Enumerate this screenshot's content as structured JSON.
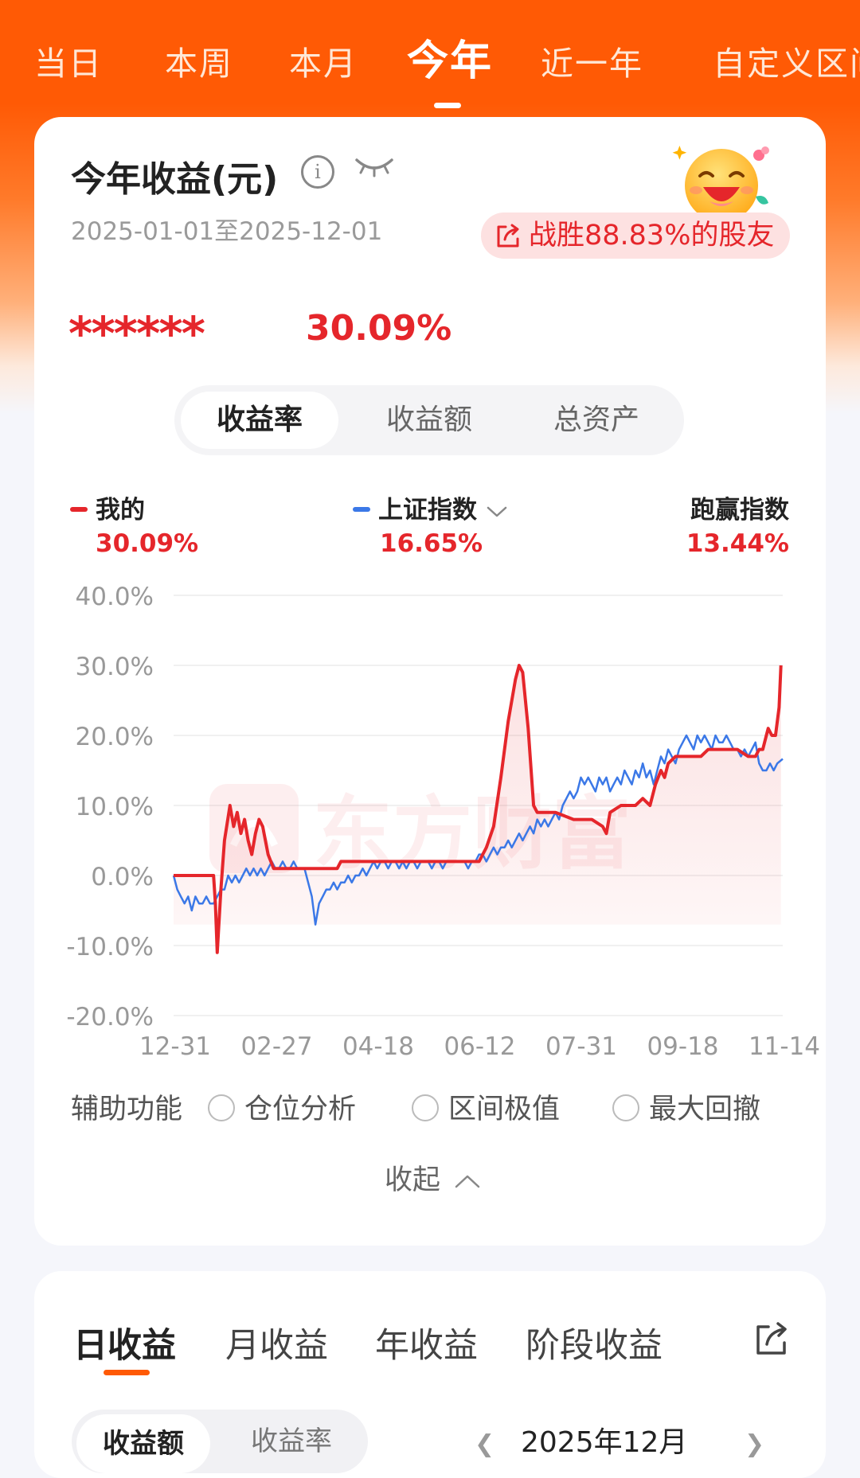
{
  "top_tabs": [
    "当日",
    "本周",
    "本月",
    "今年",
    "近一年",
    "自定义区间"
  ],
  "top_tabs_active": "今年",
  "summary": {
    "title": "今年收益(元)",
    "date_range": "2025-01-01至2025-12-01",
    "beat_text": "战胜88.83%的股友",
    "masked_amount": "******",
    "return_pct": "30.09%"
  },
  "metric_tabs": [
    "收益率",
    "收益额",
    "总资产"
  ],
  "metric_tabs_active": "收益率",
  "legend": {
    "mine_label": "我的",
    "mine_value": "30.09%",
    "index_label": "上证指数",
    "index_value": "16.65%",
    "excess_label": "跑赢指数",
    "excess_value": "13.44%"
  },
  "watermark": "东方财富",
  "chart_data": {
    "type": "line",
    "ylim": [
      -20,
      40
    ],
    "yticks": [
      "40.0%",
      "30.0%",
      "20.0%",
      "10.0%",
      "0.0%",
      "-10.0%",
      "-20.0%"
    ],
    "xticks": [
      "12-31",
      "02-27",
      "04-18",
      "06-12",
      "07-31",
      "09-18",
      "11-14"
    ],
    "x_range_days": [
      0,
      335
    ],
    "colors": {
      "mine": "#e5262b",
      "index": "#3b78e7"
    },
    "series": [
      {
        "name": "我的",
        "points": [
          [
            0,
            0
          ],
          [
            22,
            0
          ],
          [
            23,
            -4
          ],
          [
            24,
            -11
          ],
          [
            26,
            -2
          ],
          [
            28,
            5
          ],
          [
            31,
            10
          ],
          [
            33,
            7
          ],
          [
            35,
            9
          ],
          [
            37,
            6
          ],
          [
            39,
            8
          ],
          [
            41,
            5
          ],
          [
            43,
            3
          ],
          [
            45,
            6
          ],
          [
            47,
            8
          ],
          [
            49,
            7
          ],
          [
            52,
            3
          ],
          [
            55,
            1
          ],
          [
            58,
            1
          ],
          [
            62,
            1
          ],
          [
            66,
            1
          ],
          [
            72,
            1
          ],
          [
            80,
            1
          ],
          [
            90,
            1
          ],
          [
            92,
            2
          ],
          [
            100,
            2
          ],
          [
            120,
            2
          ],
          [
            140,
            2
          ],
          [
            160,
            2
          ],
          [
            168,
            2
          ],
          [
            170,
            3
          ],
          [
            172,
            4
          ],
          [
            176,
            7
          ],
          [
            180,
            14
          ],
          [
            184,
            22
          ],
          [
            188,
            28
          ],
          [
            190,
            30
          ],
          [
            192,
            29
          ],
          [
            195,
            21
          ],
          [
            198,
            10
          ],
          [
            200,
            9
          ],
          [
            204,
            9
          ],
          [
            210,
            9
          ],
          [
            220,
            8
          ],
          [
            230,
            8
          ],
          [
            236,
            7
          ],
          [
            238,
            6
          ],
          [
            240,
            9
          ],
          [
            246,
            10
          ],
          [
            254,
            10
          ],
          [
            258,
            11
          ],
          [
            262,
            10
          ],
          [
            265,
            13
          ],
          [
            268,
            15
          ],
          [
            270,
            14
          ],
          [
            272,
            16
          ],
          [
            276,
            17
          ],
          [
            285,
            17
          ],
          [
            290,
            17
          ],
          [
            294,
            18
          ],
          [
            300,
            18
          ],
          [
            310,
            18
          ],
          [
            316,
            17
          ],
          [
            320,
            17
          ],
          [
            322,
            18
          ],
          [
            324,
            18
          ],
          [
            326,
            20
          ],
          [
            327,
            21
          ],
          [
            329,
            20
          ],
          [
            331,
            20
          ],
          [
            333,
            24
          ],
          [
            334,
            30
          ]
        ]
      },
      {
        "name": "上证指数",
        "points": [
          [
            0,
            0
          ],
          [
            2,
            -2
          ],
          [
            4,
            -3
          ],
          [
            6,
            -4
          ],
          [
            8,
            -3
          ],
          [
            10,
            -5
          ],
          [
            12,
            -3
          ],
          [
            14,
            -4
          ],
          [
            16,
            -4
          ],
          [
            18,
            -3
          ],
          [
            20,
            -4
          ],
          [
            22,
            -4
          ],
          [
            24,
            -3
          ],
          [
            26,
            -2
          ],
          [
            28,
            -2
          ],
          [
            30,
            0
          ],
          [
            32,
            -1
          ],
          [
            34,
            0
          ],
          [
            36,
            -1
          ],
          [
            38,
            0
          ],
          [
            40,
            1
          ],
          [
            42,
            0
          ],
          [
            44,
            1
          ],
          [
            46,
            0
          ],
          [
            48,
            1
          ],
          [
            50,
            0
          ],
          [
            52,
            1
          ],
          [
            54,
            2
          ],
          [
            56,
            1
          ],
          [
            58,
            1
          ],
          [
            60,
            2
          ],
          [
            62,
            1
          ],
          [
            64,
            1
          ],
          [
            66,
            2
          ],
          [
            68,
            1
          ],
          [
            70,
            1
          ],
          [
            72,
            1
          ],
          [
            74,
            -1
          ],
          [
            76,
            -3
          ],
          [
            78,
            -7
          ],
          [
            80,
            -4
          ],
          [
            82,
            -3
          ],
          [
            84,
            -2
          ],
          [
            86,
            -2
          ],
          [
            88,
            -1
          ],
          [
            90,
            -2
          ],
          [
            92,
            -1
          ],
          [
            94,
            -1
          ],
          [
            96,
            0
          ],
          [
            98,
            -1
          ],
          [
            100,
            0
          ],
          [
            102,
            0
          ],
          [
            104,
            1
          ],
          [
            106,
            0
          ],
          [
            108,
            1
          ],
          [
            110,
            2
          ],
          [
            112,
            1
          ],
          [
            114,
            2
          ],
          [
            116,
            2
          ],
          [
            118,
            1
          ],
          [
            120,
            2
          ],
          [
            122,
            2
          ],
          [
            124,
            1
          ],
          [
            126,
            2
          ],
          [
            128,
            1
          ],
          [
            130,
            2
          ],
          [
            132,
            2
          ],
          [
            134,
            1
          ],
          [
            136,
            2
          ],
          [
            138,
            2
          ],
          [
            140,
            2
          ],
          [
            142,
            1
          ],
          [
            144,
            2
          ],
          [
            146,
            2
          ],
          [
            148,
            1
          ],
          [
            150,
            2
          ],
          [
            152,
            2
          ],
          [
            154,
            2
          ],
          [
            156,
            2
          ],
          [
            158,
            2
          ],
          [
            160,
            2
          ],
          [
            162,
            1
          ],
          [
            164,
            2
          ],
          [
            166,
            2
          ],
          [
            168,
            3
          ],
          [
            170,
            3
          ],
          [
            172,
            2
          ],
          [
            174,
            3
          ],
          [
            176,
            4
          ],
          [
            178,
            3
          ],
          [
            180,
            4
          ],
          [
            182,
            4
          ],
          [
            184,
            5
          ],
          [
            186,
            4
          ],
          [
            188,
            5
          ],
          [
            190,
            6
          ],
          [
            192,
            5
          ],
          [
            194,
            6
          ],
          [
            196,
            7
          ],
          [
            198,
            6
          ],
          [
            200,
            8
          ],
          [
            202,
            7
          ],
          [
            204,
            8
          ],
          [
            206,
            7
          ],
          [
            208,
            8
          ],
          [
            210,
            9
          ],
          [
            212,
            8
          ],
          [
            214,
            10
          ],
          [
            216,
            11
          ],
          [
            218,
            12
          ],
          [
            220,
            11
          ],
          [
            222,
            12
          ],
          [
            224,
            14
          ],
          [
            226,
            13
          ],
          [
            228,
            14
          ],
          [
            230,
            13
          ],
          [
            232,
            12
          ],
          [
            234,
            14
          ],
          [
            236,
            13
          ],
          [
            238,
            14
          ],
          [
            240,
            12
          ],
          [
            242,
            13
          ],
          [
            244,
            14
          ],
          [
            246,
            13
          ],
          [
            248,
            15
          ],
          [
            250,
            14
          ],
          [
            252,
            13
          ],
          [
            254,
            15
          ],
          [
            256,
            14
          ],
          [
            258,
            16
          ],
          [
            260,
            14
          ],
          [
            262,
            15
          ],
          [
            264,
            13
          ],
          [
            266,
            15
          ],
          [
            268,
            17
          ],
          [
            270,
            16
          ],
          [
            272,
            18
          ],
          [
            274,
            17
          ],
          [
            276,
            16
          ],
          [
            278,
            18
          ],
          [
            280,
            19
          ],
          [
            282,
            20
          ],
          [
            284,
            19
          ],
          [
            286,
            18
          ],
          [
            288,
            20
          ],
          [
            290,
            19
          ],
          [
            292,
            20
          ],
          [
            294,
            19
          ],
          [
            296,
            18
          ],
          [
            298,
            20
          ],
          [
            300,
            19
          ],
          [
            302,
            19
          ],
          [
            304,
            20
          ],
          [
            306,
            19
          ],
          [
            308,
            18
          ],
          [
            310,
            18
          ],
          [
            312,
            17
          ],
          [
            314,
            18
          ],
          [
            316,
            17
          ],
          [
            318,
            18
          ],
          [
            320,
            19
          ],
          [
            322,
            16
          ],
          [
            324,
            15
          ],
          [
            326,
            15
          ],
          [
            328,
            16
          ],
          [
            330,
            15
          ],
          [
            332,
            16
          ],
          [
            335,
            16.65
          ]
        ]
      }
    ]
  },
  "assist": {
    "label": "辅助功能",
    "options": [
      "仓位分析",
      "区间极值",
      "最大回撤"
    ]
  },
  "collapse_label": "收起",
  "bottom_card": {
    "tabs": [
      "日收益",
      "月收益",
      "年收益",
      "阶段收益"
    ],
    "tabs_active": "日收益",
    "sub_tabs": [
      "收益额",
      "收益率"
    ],
    "sub_tabs_active": "收益额",
    "month": "2025年12月"
  }
}
